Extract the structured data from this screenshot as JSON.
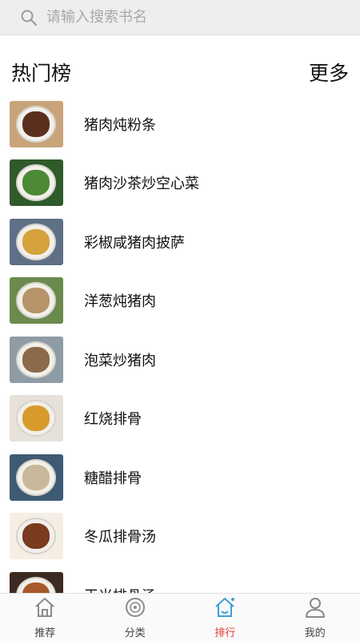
{
  "search": {
    "placeholder": "请输入搜索书名"
  },
  "section": {
    "title": "热门榜",
    "more_label": "更多"
  },
  "items": [
    {
      "title": "猪肉炖粉条",
      "bg": "#c9a47a",
      "food": "#5a2f1d"
    },
    {
      "title": "猪肉沙茶炒空心菜",
      "bg": "#2f5a2a",
      "food": "#4c8a35"
    },
    {
      "title": "彩椒咸猪肉披萨",
      "bg": "#5f6f86",
      "food": "#d6a23c"
    },
    {
      "title": "洋葱炖猪肉",
      "bg": "#6b8a4e",
      "food": "#b79469"
    },
    {
      "title": "泡菜炒猪肉",
      "bg": "#8e9ca6",
      "food": "#8a6a4a"
    },
    {
      "title": "红烧排骨",
      "bg": "#e6e2da",
      "food": "#d89a2c"
    },
    {
      "title": "糖醋排骨",
      "bg": "#3e5a74",
      "food": "#c8b79a"
    },
    {
      "title": "冬瓜排骨汤",
      "bg": "#f4eee4",
      "food": "#7a3b1f"
    },
    {
      "title": "玉米排骨汤",
      "bg": "#3a2a20",
      "food": "#a65a2a"
    }
  ],
  "tabs": [
    {
      "label": "推荐",
      "icon": "home-icon",
      "active": false
    },
    {
      "label": "分类",
      "icon": "disc-icon",
      "active": false
    },
    {
      "label": "排行",
      "icon": "rank-home-icon",
      "active": true
    },
    {
      "label": "我的",
      "icon": "user-icon",
      "active": false
    }
  ],
  "colors": {
    "active": "#e53935",
    "active_icon": "#3d9fd6",
    "inactive_icon": "#8a8a8a"
  }
}
